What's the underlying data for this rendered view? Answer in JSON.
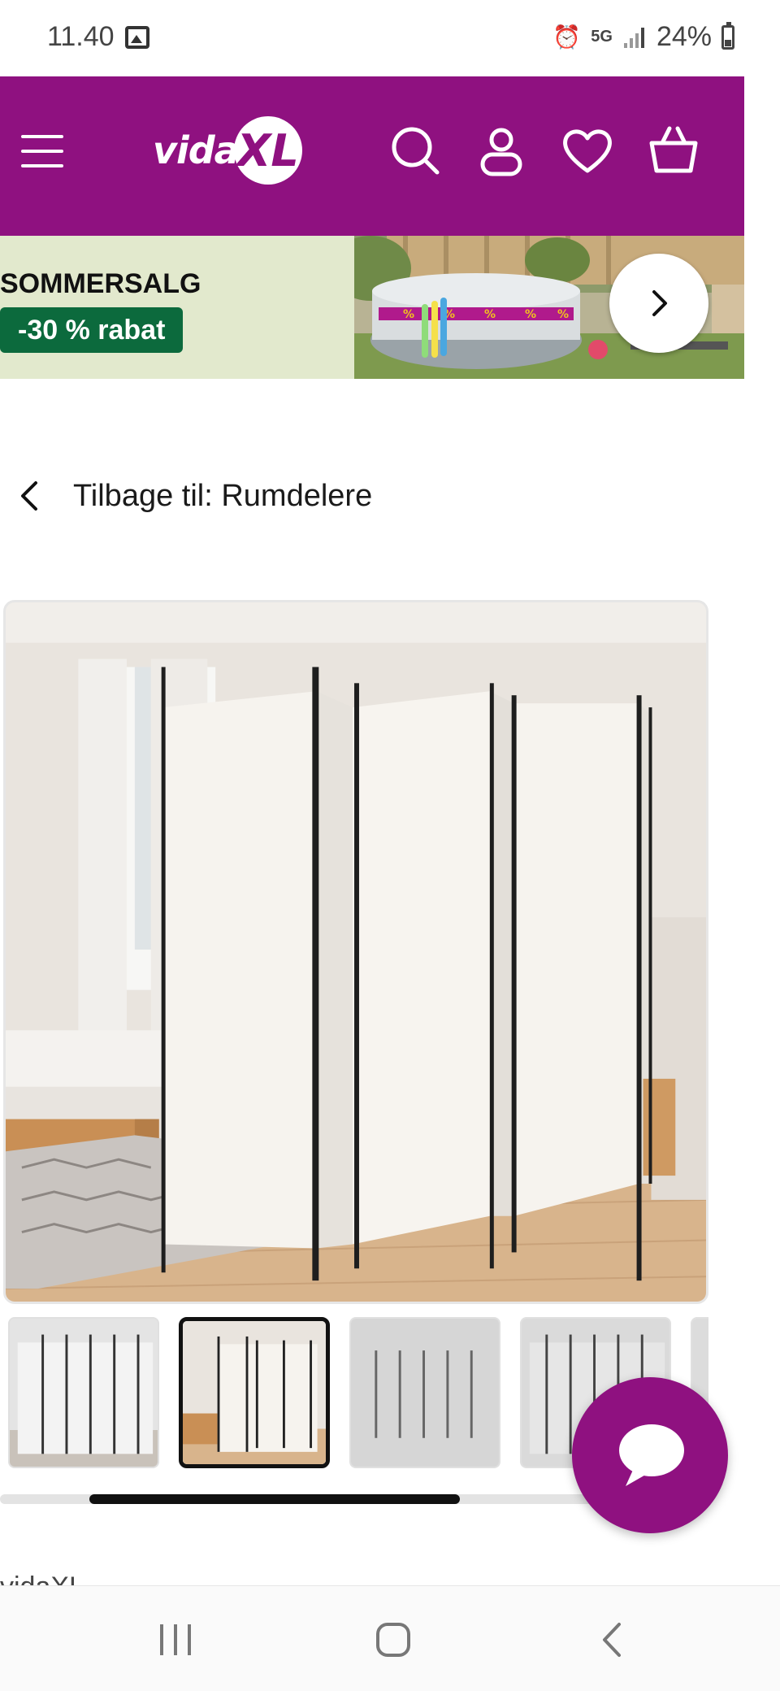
{
  "status_bar": {
    "time": "11.40",
    "network": "5G",
    "battery": "24%"
  },
  "header": {
    "logo_text": "vida",
    "logo_badge": "XL",
    "brand_color": "#8f1180",
    "icons": [
      "menu-icon",
      "search-icon",
      "account-icon",
      "heart-icon",
      "cart-icon"
    ]
  },
  "banner": {
    "title": "SOMMERSALG",
    "badge": "-30 % rabat",
    "badge_color": "#0c6a3d",
    "background": "#e2e9cd"
  },
  "breadcrumb": {
    "label": "Tilbage til: Rumdelere"
  },
  "gallery": {
    "thumbnail_count_visible": 5,
    "active_thumbnail": 2
  },
  "brand_peek": "vidaXL",
  "nav_bar": {
    "icons": [
      "recent-apps-icon",
      "home-icon",
      "back-icon"
    ]
  }
}
